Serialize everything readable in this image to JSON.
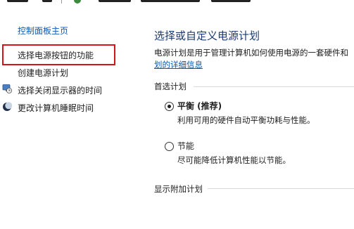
{
  "sidebar": {
    "home_link": "控制面板主页",
    "items": [
      {
        "label": "选择电源按钮的功能",
        "icon": ""
      },
      {
        "label": "创建电源计划",
        "icon": ""
      },
      {
        "label": "选择关闭显示器的时间",
        "icon": "monitor-clock-icon"
      },
      {
        "label": "更改计算机睡眠时间",
        "icon": "moon-icon"
      }
    ],
    "highlight_color": "#d1141d",
    "link_color": "#0b59b0"
  },
  "main": {
    "title": "选择或自定义电源计划",
    "description": "电源计划是用于管理计算机如何使用电源的一套硬件和",
    "description_link": "划的详细信息",
    "preferred_group": "首选计划",
    "plans": [
      {
        "name": "平衡 (推荐)",
        "description": "利用可用的硬件自动平衡功耗与性能。",
        "selected": true
      },
      {
        "name": "节能",
        "description": "尽可能降低计算机性能以节能。",
        "selected": false
      }
    ],
    "additional_group": "显示附加计划"
  }
}
